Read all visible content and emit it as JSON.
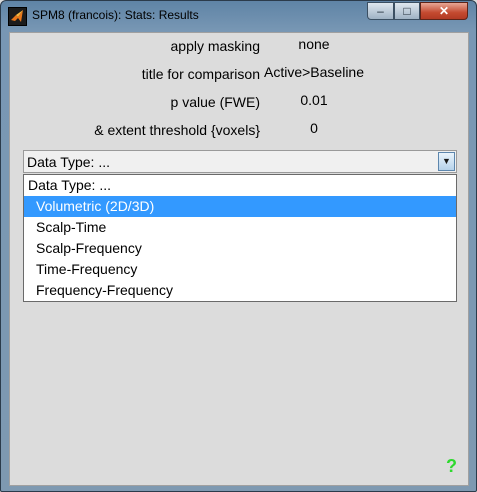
{
  "window": {
    "title": "SPM8 (francois): Stats: Results",
    "minimize": "–",
    "maximize": "□",
    "close": "✕"
  },
  "params": [
    {
      "label": "apply masking",
      "value": "none"
    },
    {
      "label": "title for comparison",
      "value": "Active>Baseline"
    },
    {
      "label": "p value (FWE)",
      "value": "0.01"
    },
    {
      "label": "& extent threshold {voxels}",
      "value": "0"
    }
  ],
  "dropdown": {
    "current": "Data Type: ...",
    "arrow": "▼",
    "options": [
      "Data Type: ...",
      "Volumetric (2D/3D)",
      "Scalp-Time",
      "Scalp-Frequency",
      "Time-Frequency",
      "Frequency-Frequency"
    ],
    "highlighted": "Volumetric (2D/3D)"
  },
  "help": "?",
  "colors": {
    "highlight": "#3399ff",
    "help": "#2ed92e",
    "title_gradient_top": "#5f84a6"
  }
}
